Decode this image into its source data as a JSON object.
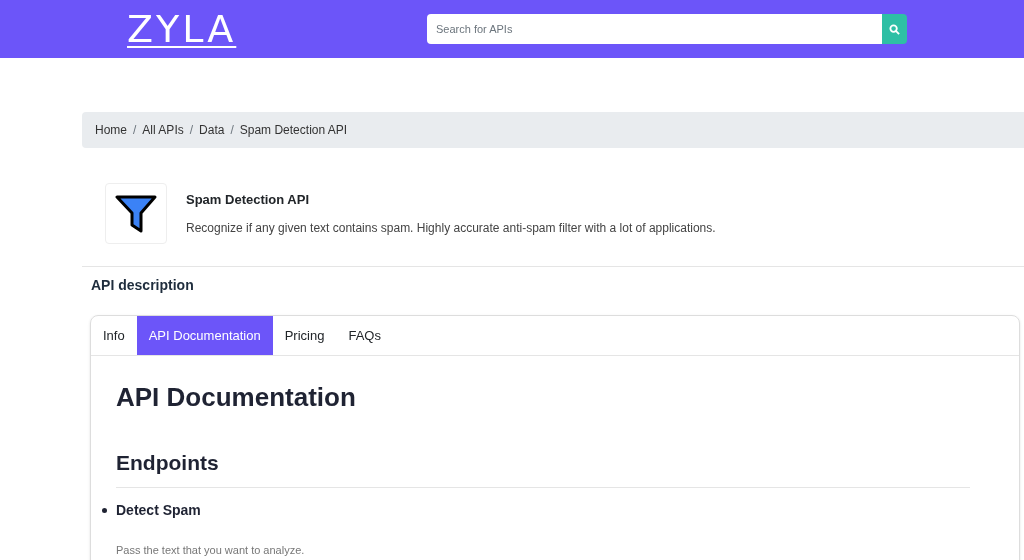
{
  "header": {
    "logo": "ZYLA",
    "search": {
      "placeholder": "Search for APIs"
    }
  },
  "breadcrumb": [
    "Home",
    "All APIs",
    "Data",
    "Spam Detection API"
  ],
  "breadcrumb_separator": "/",
  "api": {
    "title": "Spam Detection API",
    "description": "Recognize if any given text contains spam. Highly accurate anti-spam filter with a lot of applications."
  },
  "section_title": "API description",
  "tabs": [
    {
      "label": "Info",
      "selected": false
    },
    {
      "label": "API Documentation",
      "selected": true
    },
    {
      "label": "Pricing",
      "selected": false
    },
    {
      "label": "FAQs",
      "selected": false
    }
  ],
  "content": {
    "heading": "API Documentation",
    "subheading": "Endpoints",
    "endpoints": [
      {
        "name": "Detect Spam",
        "description": "Pass the text that you want to analyze."
      }
    ]
  }
}
